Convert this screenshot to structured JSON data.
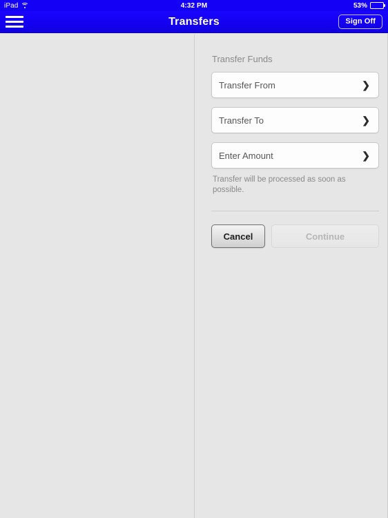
{
  "status_bar": {
    "device": "iPad",
    "wifi_icon": "wifi-icon",
    "time": "4:32 PM",
    "battery_percent": "53%",
    "battery_level": 53
  },
  "nav_bar": {
    "menu_icon": "hamburger-menu-icon",
    "title": "Transfers",
    "sign_off_label": "Sign Off"
  },
  "main": {
    "section_title": "Transfer Funds",
    "fields": [
      {
        "label": "Transfer From",
        "chevron": "❯"
      },
      {
        "label": "Transfer To",
        "chevron": "❯"
      },
      {
        "label": "Enter Amount",
        "chevron": "❯"
      }
    ],
    "helper_text": "Transfer will be processed as soon as possible.",
    "buttons": {
      "cancel_label": "Cancel",
      "continue_label": "Continue"
    }
  },
  "colors": {
    "nav_blue": "#1400f5",
    "page_background": "#e6e6e6",
    "field_background": "#fdfdfd",
    "muted_text": "#8a8a8a"
  }
}
